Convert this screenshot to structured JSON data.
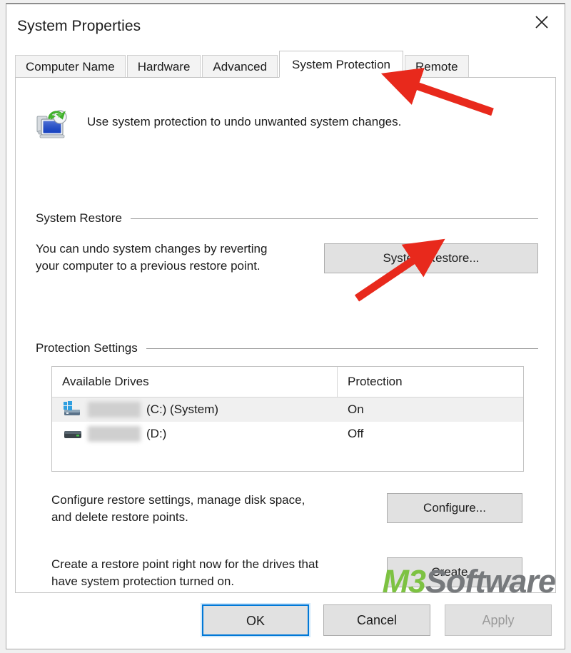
{
  "window": {
    "title": "System Properties",
    "close_icon": "close-icon"
  },
  "tabs": [
    {
      "label": "Computer Name",
      "selected": false
    },
    {
      "label": "Hardware",
      "selected": false
    },
    {
      "label": "Advanced",
      "selected": false
    },
    {
      "label": "System Protection",
      "selected": true
    },
    {
      "label": "Remote",
      "selected": false
    }
  ],
  "intro": {
    "icon": "system-protection-icon",
    "description": "Use system protection to undo unwanted system changes."
  },
  "system_restore": {
    "group_label": "System Restore",
    "description_line1": "You can undo system changes by reverting",
    "description_line2": "your computer to a previous restore point.",
    "button_label": "System Restore..."
  },
  "protection_settings": {
    "group_label": "Protection Settings",
    "columns": [
      "Available Drives",
      "Protection"
    ],
    "rows": [
      {
        "drive_icon": "windows-drive-icon",
        "label_redacted": true,
        "drive": "(C:) (System)",
        "protection": "On",
        "selected": true
      },
      {
        "drive_icon": "hard-drive-icon",
        "label_redacted": true,
        "drive": "(D:)",
        "protection": "Off",
        "selected": false
      }
    ]
  },
  "configure": {
    "description_line1": "Configure restore settings, manage disk space,",
    "description_line2": "and delete restore points.",
    "button_label": "Configure..."
  },
  "create": {
    "description_line1": "Create a restore point right now for the drives that",
    "description_line2": "have system protection turned on.",
    "button_label": "Create..."
  },
  "footer": {
    "ok_label": "OK",
    "cancel_label": "Cancel",
    "apply_label": "Apply",
    "apply_disabled": true
  },
  "watermark": {
    "brand_primary": "M3",
    "brand_secondary": "Software",
    "primary_color": "#7dc242",
    "secondary_color": "#76797c"
  },
  "annotations": {
    "arrow_color": "#e8291c",
    "arrows": [
      {
        "name": "arrow-to-system-protection-tab",
        "points_to": "System Protection tab"
      },
      {
        "name": "arrow-to-system-restore-button",
        "points_to": "System Restore... button"
      }
    ]
  }
}
